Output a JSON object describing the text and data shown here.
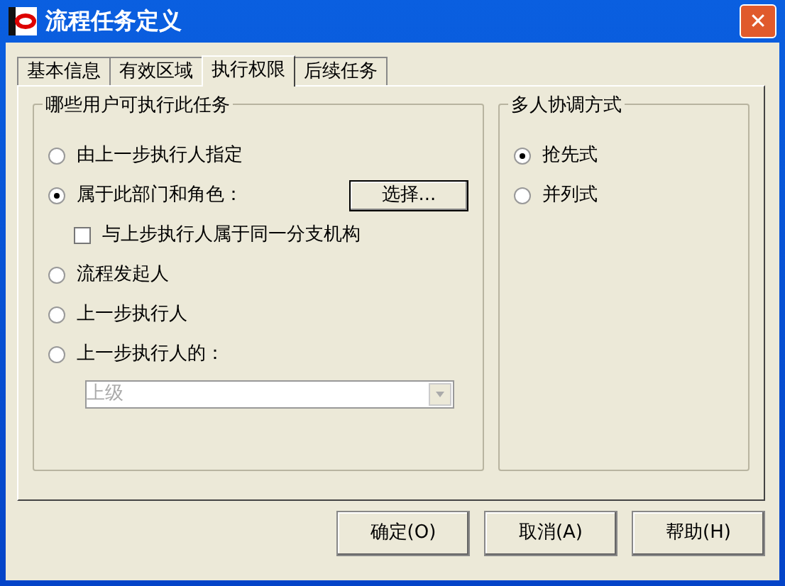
{
  "window": {
    "title": "流程任务定义",
    "close": "✕"
  },
  "tabs": [
    {
      "label": "基本信息",
      "selected": false
    },
    {
      "label": "有效区域",
      "selected": false
    },
    {
      "label": "执行权限",
      "selected": true
    },
    {
      "label": "后续任务",
      "selected": false
    }
  ],
  "users_group": {
    "title": "哪些用户可执行此任务",
    "options": [
      {
        "kind": "radio",
        "label": "由上一步执行人指定",
        "selected": false
      },
      {
        "kind": "radio-button",
        "label": "属于此部门和角色：",
        "selected": true,
        "button": "选择..."
      },
      {
        "kind": "checkbox",
        "label": "与上步执行人属于同一分支机构",
        "checked": false
      },
      {
        "kind": "radio",
        "label": "流程发起人",
        "selected": false
      },
      {
        "kind": "radio",
        "label": "上一步执行人",
        "selected": false
      },
      {
        "kind": "radio",
        "label": "上一步执行人的：",
        "selected": false
      },
      {
        "kind": "dropdown",
        "value": "上级",
        "disabled": true
      }
    ]
  },
  "mode_group": {
    "title": "多人协调方式",
    "options": [
      {
        "label": "抢先式",
        "selected": true
      },
      {
        "label": "并列式",
        "selected": false
      }
    ]
  },
  "buttons": [
    "确定(O)",
    "取消(A)",
    "帮助(H)"
  ]
}
